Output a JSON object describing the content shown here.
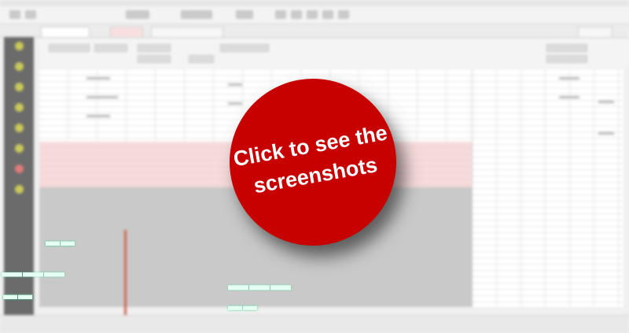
{
  "cta": {
    "line1": "Click to see the",
    "line2": "screenshots"
  },
  "colors": {
    "cta_red": "#c70000",
    "sidebar": "#6b6b6b",
    "grid_pink": "#f6dcdd",
    "grid_gray": "#c9c9c9"
  }
}
